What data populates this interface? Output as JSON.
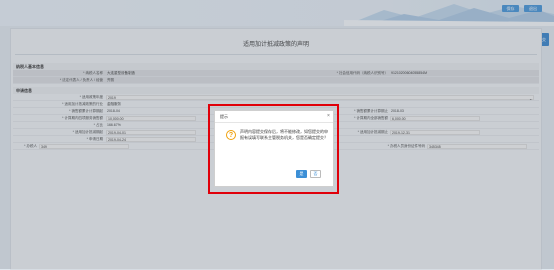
{
  "header": {
    "btn_save": "保存",
    "btn_exit": "退出"
  },
  "side": {
    "btn": "提交"
  },
  "page": {
    "title": "适用加计抵减政策的声明"
  },
  "section1": {
    "title": "纳税人基本信息",
    "row1": {
      "label": "* 纳税人名称",
      "value": "大连重型设备制造",
      "label2": "* 社会信用代码（纳税人识别号）",
      "value2": "91210200604055854M"
    },
    "row2": {
      "label": "* 法定代表人 / 负责人 / 经营",
      "value": "齐丽"
    }
  },
  "section2": {
    "title": "申请信息",
    "rows": [
      {
        "label": "* 适用政策年度",
        "value": "2019"
      },
      {
        "label": "* 适用加计抵减政策的行业",
        "value": "金融服务"
      },
      {
        "label": "* 销售额累计计算期起",
        "value": "2018-04",
        "label2": "* 销售额累计计算期止",
        "value2": "2018-03"
      },
      {
        "label": "* 计算期内四项服务销售额",
        "value": "10,000.00",
        "label2": "* 计算期内全部销售额",
        "value2": "6,000.00"
      },
      {
        "label": "* 占比",
        "value": "166.67%"
      },
      {
        "label": "* 适用加计抵减期起",
        "value": "2019-04-01",
        "label2": "* 适用加计抵减期止",
        "value2": "2019-12-31"
      },
      {
        "label": "* 申请日期",
        "value": "2019-04-24"
      },
      {
        "label": "* 办税人",
        "value": "349",
        "label2": "* 办税人员身份证件号码",
        "value2": "345345"
      }
    ]
  },
  "dialog": {
    "title": "提示",
    "close": "×",
    "message": "声明内容提交保存后，将不能修改，如您提交的申报有误填写联系主管税务机关，您是否确定提交？",
    "ok": "是",
    "cancel": "否"
  },
  "colors": {
    "accent": "#3c8fd6",
    "highlight": "#e0000a",
    "warning": "#f0a10c"
  }
}
